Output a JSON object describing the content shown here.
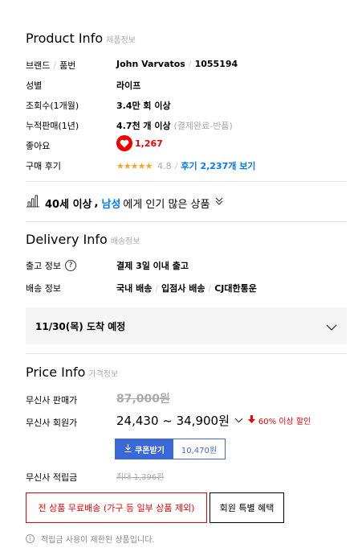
{
  "product_info": {
    "title": "Product Info",
    "subtitle": "제품정보",
    "brand_label": "브랜드",
    "product_no_label": "품번",
    "brand_value": "John Varvatos",
    "product_no_value": "1055194",
    "gender_label": "성별",
    "gender_value": "라이프",
    "views_label": "조회수(1개월)",
    "views_value": "3.4만 회 이상",
    "sales_label": "누적판매(1년)",
    "sales_value": "4.7천 개 이상",
    "sales_note": "(결제완료-반품)",
    "likes_label": "좋아요",
    "likes_value": "1,267",
    "review_label": "구매 후기",
    "review_stars": "★★★★★",
    "review_score": "4.8",
    "review_link": "후기 2,237개 보기"
  },
  "popular": {
    "age": "40세 이상",
    "comma": ",",
    "gender": "남성",
    "rest": "에게 인기 많은 상품"
  },
  "delivery_info": {
    "title": "Delivery Info",
    "subtitle": "배송정보",
    "ship_label": "출고 정보",
    "ship_value": "결제 3일 이내 출고",
    "method_label": "배송 정보",
    "method_1": "국내 배송",
    "method_2": "입점사 배송",
    "method_3": "CJ대한통운",
    "arrival": "11/30(목) 도착 예정"
  },
  "price_info": {
    "title": "Price Info",
    "subtitle": "가격정보",
    "sale_label": "무신사 판매가",
    "sale_value": "87,000원",
    "member_label": "무신사 회원가",
    "member_value": "24,430 ~ 34,900원",
    "discount": "60% 이상 할인",
    "coupon_button": "쿠폰받기",
    "coupon_value": "10,470원",
    "points_label": "무신사 적립금",
    "points_value": "최대 1,396원",
    "free_shipping": "전 상품 무료배송 (가구 등 일부 상품 제외)",
    "member_benefit": "회원 특별 혜택",
    "notice": "적립금 사용이 제한된 상품입니다."
  },
  "colors": {
    "accent_blue": "#0078ff",
    "discount_red": "#f10000",
    "coupon_blue": "#3a68d8",
    "star": "#f5a623"
  }
}
